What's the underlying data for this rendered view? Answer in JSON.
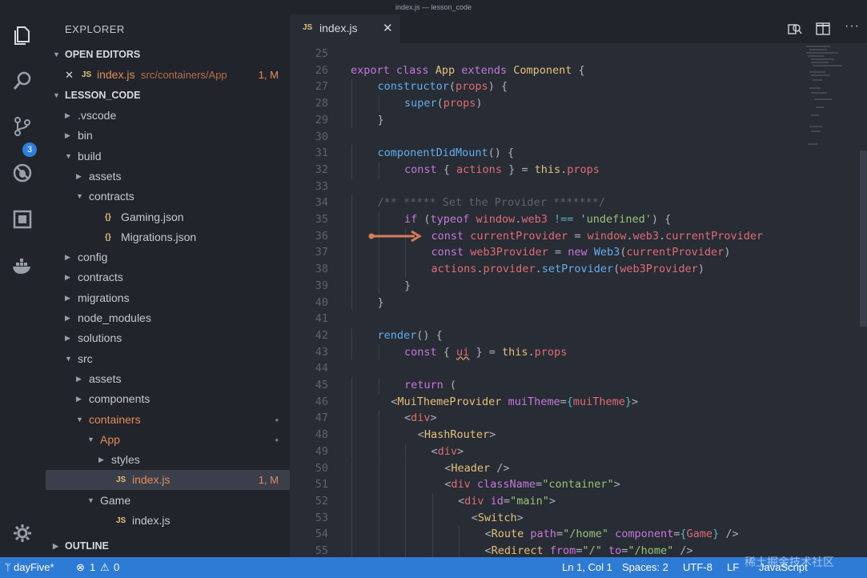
{
  "window": {
    "title": "index.js — lesson_code"
  },
  "activity_bar": {
    "scm_badge": "3",
    "icons": [
      "files-icon",
      "search-icon",
      "source-control-icon",
      "debug-icon",
      "extensions-icon",
      "docker-icon",
      "settings-gear-icon"
    ]
  },
  "sidebar": {
    "title": "EXPLORER",
    "open_editors": {
      "label": "OPEN EDITORS",
      "items": [
        {
          "close": "✕",
          "icon": "JS",
          "name": "index.js",
          "path": "src/containers/App",
          "status": "1, M"
        }
      ]
    },
    "workspace": {
      "label": "LESSON_CODE",
      "tree": [
        {
          "name": ".vscode",
          "twisty": "›",
          "depth": 0
        },
        {
          "name": "bin",
          "twisty": "›",
          "depth": 0
        },
        {
          "name": "build",
          "twisty": "⌄",
          "depth": 0
        },
        {
          "name": "assets",
          "twisty": "›",
          "depth": 1
        },
        {
          "name": "contracts",
          "twisty": "⌄",
          "depth": 1
        },
        {
          "name": "Gaming.json",
          "icon": "{}",
          "depth": 2
        },
        {
          "name": "Migrations.json",
          "icon": "{}",
          "depth": 2
        },
        {
          "name": "config",
          "twisty": "›",
          "depth": 0
        },
        {
          "name": "contracts",
          "twisty": "›",
          "depth": 0
        },
        {
          "name": "migrations",
          "twisty": "›",
          "depth": 0
        },
        {
          "name": "node_modules",
          "twisty": "›",
          "depth": 0
        },
        {
          "name": "solutions",
          "twisty": "›",
          "depth": 0
        },
        {
          "name": "src",
          "twisty": "⌄",
          "depth": 0
        },
        {
          "name": "assets",
          "twisty": "›",
          "depth": 1
        },
        {
          "name": "components",
          "twisty": "›",
          "depth": 1
        },
        {
          "name": "containers",
          "twisty": "⌄",
          "depth": 1,
          "modified": true,
          "status": "•"
        },
        {
          "name": "App",
          "twisty": "⌄",
          "depth": 2,
          "modified": true,
          "status": "•"
        },
        {
          "name": "styles",
          "twisty": "›",
          "depth": 3
        },
        {
          "name": "index.js",
          "icon": "JS",
          "depth": 3,
          "modified": true,
          "selected": true,
          "status": "1, M"
        },
        {
          "name": "Game",
          "twisty": "⌄",
          "depth": 2
        },
        {
          "name": "index.js",
          "icon": "JS",
          "depth": 3
        }
      ]
    },
    "outline_label": "OUTLINE"
  },
  "editor": {
    "tab": {
      "icon": "JS",
      "name": "index.js",
      "close": "✕"
    },
    "lines": [
      {
        "n": "25",
        "i": 0,
        "t": []
      },
      {
        "n": "26",
        "i": 0,
        "t": [
          [
            "k",
            "export "
          ],
          [
            "k",
            "class "
          ],
          [
            "ty",
            "App "
          ],
          [
            "k",
            "extends "
          ],
          [
            "ty",
            "Component "
          ],
          [
            "p",
            "{"
          ]
        ]
      },
      {
        "n": "27",
        "i": 1,
        "t": [
          [
            "f",
            "constructor"
          ],
          [
            "p",
            "("
          ],
          [
            "v",
            "props"
          ],
          [
            "p",
            ") {"
          ]
        ]
      },
      {
        "n": "28",
        "i": 2,
        "t": [
          [
            "f",
            "super"
          ],
          [
            "p",
            "("
          ],
          [
            "v",
            "props"
          ],
          [
            "p",
            ")"
          ]
        ]
      },
      {
        "n": "29",
        "i": 1,
        "t": [
          [
            "p",
            "}"
          ]
        ]
      },
      {
        "n": "30",
        "i": 0,
        "t": []
      },
      {
        "n": "31",
        "i": 1,
        "t": [
          [
            "f",
            "componentDidMount"
          ],
          [
            "p",
            "() {"
          ]
        ]
      },
      {
        "n": "32",
        "i": 2,
        "t": [
          [
            "k",
            "const "
          ],
          [
            "p",
            "{ "
          ],
          [
            "v",
            "actions"
          ],
          [
            "p",
            " } = "
          ],
          [
            "ty",
            "this"
          ],
          [
            "p",
            "."
          ],
          [
            "v",
            "props"
          ]
        ]
      },
      {
        "n": "33",
        "i": 0,
        "t": []
      },
      {
        "n": "34",
        "i": 1,
        "t": [
          [
            "c",
            "/** ***** Set the Provider *******/"
          ]
        ]
      },
      {
        "n": "35",
        "i": 2,
        "t": [
          [
            "k",
            "if "
          ],
          [
            "p",
            "("
          ],
          [
            "k",
            "typeof "
          ],
          [
            "v",
            "window"
          ],
          [
            "p",
            "."
          ],
          [
            "v",
            "web3 "
          ],
          [
            "o",
            "!== "
          ],
          [
            "s",
            "'undefined'"
          ],
          [
            "p",
            ") {"
          ]
        ]
      },
      {
        "n": "36",
        "i": 3,
        "t": [
          [
            "k",
            "const "
          ],
          [
            "v",
            "currentProvider "
          ],
          [
            "p",
            "= "
          ],
          [
            "v",
            "window"
          ],
          [
            "p",
            "."
          ],
          [
            "v",
            "web3"
          ],
          [
            "p",
            "."
          ],
          [
            "v",
            "currentProvider"
          ]
        ]
      },
      {
        "n": "37",
        "i": 3,
        "t": [
          [
            "k",
            "const "
          ],
          [
            "v",
            "web3Provider "
          ],
          [
            "p",
            "= "
          ],
          [
            "k",
            "new "
          ],
          [
            "f",
            "Web3"
          ],
          [
            "p",
            "("
          ],
          [
            "v",
            "currentProvider"
          ],
          [
            "p",
            ")"
          ]
        ]
      },
      {
        "n": "38",
        "i": 3,
        "t": [
          [
            "v",
            "actions"
          ],
          [
            "p",
            "."
          ],
          [
            "v",
            "provider"
          ],
          [
            "p",
            "."
          ],
          [
            "f",
            "setProvider"
          ],
          [
            "p",
            "("
          ],
          [
            "v",
            "web3Provider"
          ],
          [
            "p",
            ")"
          ]
        ]
      },
      {
        "n": "39",
        "i": 2,
        "t": [
          [
            "p",
            "}"
          ]
        ]
      },
      {
        "n": "40",
        "i": 1,
        "t": [
          [
            "p",
            "}"
          ]
        ]
      },
      {
        "n": "41",
        "i": 0,
        "t": []
      },
      {
        "n": "42",
        "i": 1,
        "t": [
          [
            "f",
            "render"
          ],
          [
            "p",
            "() {"
          ]
        ]
      },
      {
        "n": "43",
        "i": 2,
        "t": [
          [
            "k",
            "const "
          ],
          [
            "p",
            "{ "
          ],
          [
            "vw",
            "ui"
          ],
          [
            "p",
            " } = "
          ],
          [
            "ty",
            "this"
          ],
          [
            "p",
            "."
          ],
          [
            "v",
            "props"
          ]
        ]
      },
      {
        "n": "44",
        "i": 0,
        "t": []
      },
      {
        "n": "45",
        "i": 2,
        "t": [
          [
            "k",
            "return "
          ],
          [
            "p",
            "("
          ]
        ]
      },
      {
        "n": "46",
        "i": 1.5,
        "t": [
          [
            "p",
            "<"
          ],
          [
            "ty",
            "MuiThemeProvider "
          ],
          [
            "k",
            "muiTheme"
          ],
          [
            "p",
            "="
          ],
          [
            "o",
            "{"
          ],
          [
            "v",
            "muiTheme"
          ],
          [
            "o",
            "}"
          ],
          [
            "p",
            ">"
          ]
        ]
      },
      {
        "n": "47",
        "i": 2,
        "t": [
          [
            "p",
            "<"
          ],
          [
            "v",
            "div"
          ],
          [
            "p",
            ">"
          ]
        ]
      },
      {
        "n": "48",
        "i": 2.5,
        "t": [
          [
            "p",
            "<"
          ],
          [
            "ty",
            "HashRouter"
          ],
          [
            "p",
            ">"
          ]
        ]
      },
      {
        "n": "49",
        "i": 3,
        "t": [
          [
            "p",
            "<"
          ],
          [
            "v",
            "div"
          ],
          [
            "p",
            ">"
          ]
        ]
      },
      {
        "n": "50",
        "i": 3.5,
        "t": [
          [
            "p",
            "<"
          ],
          [
            "ty",
            "Header "
          ],
          [
            "p",
            "/>"
          ]
        ]
      },
      {
        "n": "51",
        "i": 3.5,
        "t": [
          [
            "p",
            "<"
          ],
          [
            "v",
            "div "
          ],
          [
            "k",
            "className"
          ],
          [
            "p",
            "="
          ],
          [
            "s",
            "\"container\""
          ],
          [
            "p",
            ">"
          ]
        ]
      },
      {
        "n": "52",
        "i": 4,
        "t": [
          [
            "p",
            "<"
          ],
          [
            "v",
            "div "
          ],
          [
            "k",
            "id"
          ],
          [
            "p",
            "="
          ],
          [
            "s",
            "\"main\""
          ],
          [
            "p",
            ">"
          ]
        ]
      },
      {
        "n": "53",
        "i": 4.5,
        "t": [
          [
            "p",
            "<"
          ],
          [
            "ty",
            "Switch"
          ],
          [
            "p",
            ">"
          ]
        ]
      },
      {
        "n": "54",
        "i": 5,
        "t": [
          [
            "p",
            "<"
          ],
          [
            "ty",
            "Route "
          ],
          [
            "k",
            "path"
          ],
          [
            "p",
            "="
          ],
          [
            "s",
            "\"/home\" "
          ],
          [
            "k",
            "component"
          ],
          [
            "p",
            "="
          ],
          [
            "o",
            "{"
          ],
          [
            "v",
            "Game"
          ],
          [
            "o",
            "}"
          ],
          [
            "p",
            " />"
          ]
        ]
      },
      {
        "n": "55",
        "i": 5,
        "t": [
          [
            "p",
            "<"
          ],
          [
            "ty",
            "Redirect "
          ],
          [
            "k",
            "from"
          ],
          [
            "p",
            "="
          ],
          [
            "s",
            "\"/\" "
          ],
          [
            "k",
            "to"
          ],
          [
            "p",
            "="
          ],
          [
            "s",
            "\"/home\" "
          ],
          [
            "p",
            "/>"
          ]
        ]
      }
    ]
  },
  "statusbar": {
    "branch": "dayFive*",
    "errors": "1",
    "warnings": "0",
    "position": "Ln 1, Col 1",
    "spaces": "Spaces: 2",
    "encoding": "UTF-8",
    "eol": "LF",
    "language": "JavaScript",
    "watermark": "稀土掘金技术社区"
  },
  "colors": {
    "accent": "#2e7bd6",
    "modified": "#e58a5a",
    "annotation_arrow": "#d97b5a"
  }
}
